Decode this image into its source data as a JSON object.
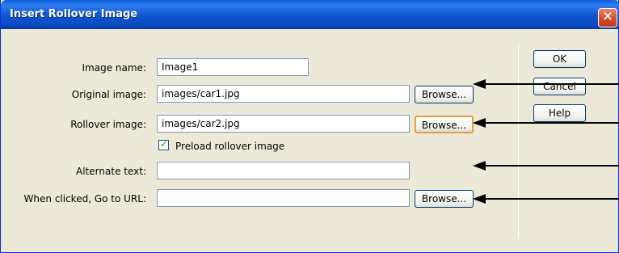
{
  "dialog": {
    "title": "Insert Rollover Image",
    "close_glyph": "✕"
  },
  "form": {
    "image_name": {
      "label": "Image name:",
      "value": "Image1"
    },
    "original_image": {
      "label": "Original image:",
      "value": "images/car1.jpg",
      "browse": "Browse..."
    },
    "rollover_image": {
      "label": "Rollover image:",
      "value": "images/car2.jpg",
      "browse": "Browse..."
    },
    "preload": {
      "label": "Preload rollover image",
      "checked": true
    },
    "alternate_text": {
      "label": "Alternate text:",
      "value": ""
    },
    "go_to_url": {
      "label": "When clicked, Go to URL:",
      "value": "",
      "browse": "Browse..."
    }
  },
  "buttons": {
    "ok": "OK",
    "cancel": "Cancel",
    "help": "Help"
  },
  "annotations": {
    "arrow_color": "#000000",
    "arrow_count": 4
  }
}
